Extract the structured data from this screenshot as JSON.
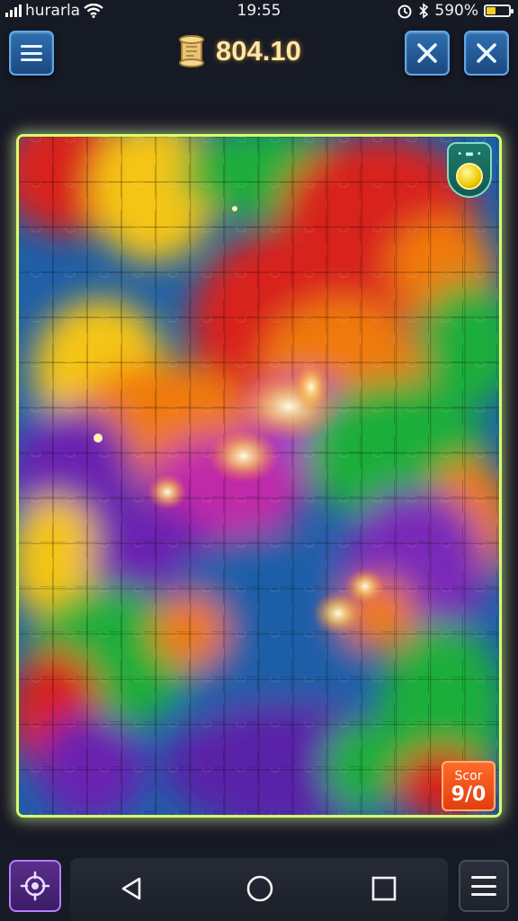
{
  "status_bar": {
    "carrier": "hurarla",
    "time": "19:55",
    "battery_text": "590%",
    "battery_level": 0.4,
    "icons": [
      "signal-icon",
      "wifi-icon",
      "alarm-icon",
      "bluetooth-icon",
      "battery-icon"
    ]
  },
  "header": {
    "menu_icon": "hamburger-icon",
    "coin_icon": "scroll-icon",
    "coin_value": "804.10",
    "buttons": [
      "close-icon",
      "close-icon"
    ]
  },
  "board": {
    "cols": 14,
    "rows": 15,
    "border_color": "#d7ff6a",
    "hint_icon": "coin-icon"
  },
  "score_badge": {
    "label": "Scor",
    "value": "9/0"
  },
  "nav": {
    "icons": [
      "locate-icon",
      "back-icon",
      "home-icon",
      "recents-icon",
      "menu-icon"
    ]
  },
  "colors": {
    "red": "#d8201c",
    "orange": "#f07a10",
    "yellow": "#f5c518",
    "green": "#1fae3a",
    "blue": "#1f5fa8",
    "purple": "#6a24b0"
  }
}
